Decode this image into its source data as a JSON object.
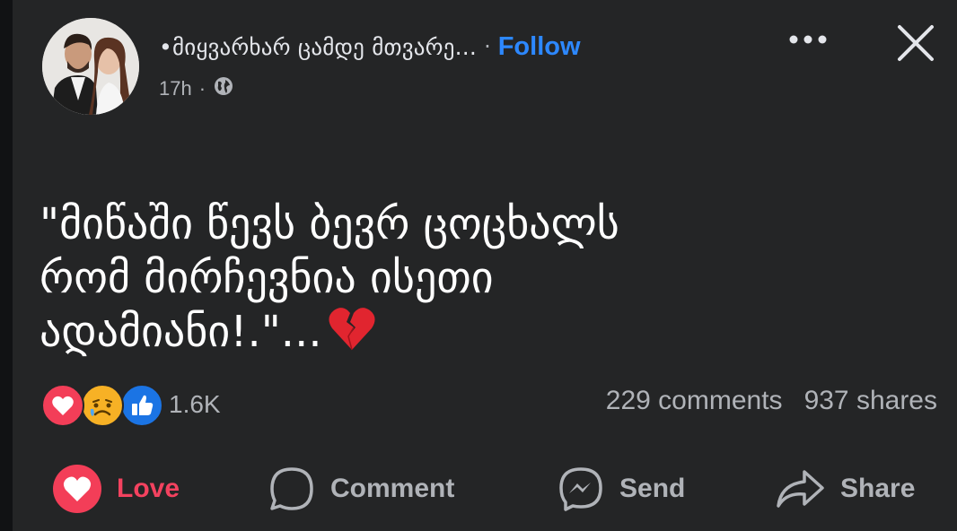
{
  "post": {
    "author": "•მიყვარხარ ცამდე მთვარე...",
    "separator": "·",
    "follow_label": "Follow",
    "time": "17h",
    "meta_separator": "·",
    "audience_icon": "globe-icon",
    "text": "\"მიწაში წევს ბევრ ცოცხალს\nრომ მირჩევნია ისეთი\nადამიანი!.\"...",
    "text_emoji": "broken-heart-icon"
  },
  "header_controls": {
    "more_icon": "more-dots-icon",
    "close_icon": "close-icon"
  },
  "reactions": {
    "icons": [
      "love-reaction-icon",
      "care-sad-reaction-icon",
      "like-reaction-icon"
    ],
    "count": "1.6K"
  },
  "stats": {
    "comments": "229 comments",
    "shares": "937 shares"
  },
  "actions": {
    "love": "Love",
    "comment": "Comment",
    "send": "Send",
    "share": "Share"
  },
  "colors": {
    "background": "#242526",
    "accent_blue": "#2d88ff",
    "love_red": "#f3425f",
    "muted_text": "#b0b3b8"
  }
}
